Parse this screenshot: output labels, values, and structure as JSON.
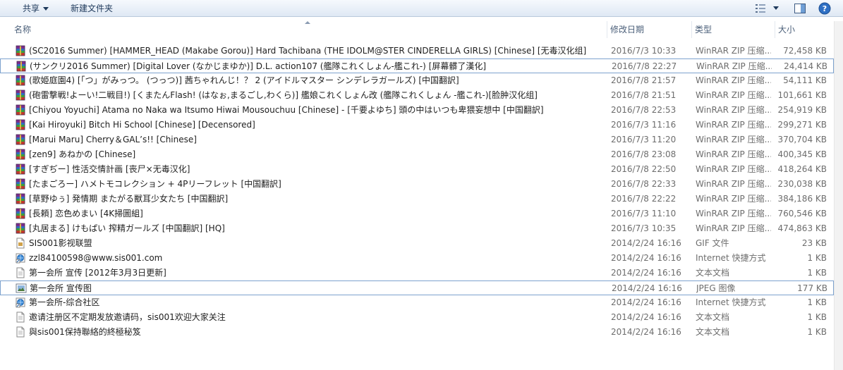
{
  "toolbar": {
    "share_label": "共享",
    "new_folder_label": "新建文件夹",
    "view_icon": "view-options-icon",
    "preview_icon": "preview-pane-icon",
    "help_icon": "help-icon"
  },
  "columns": {
    "name": "名称",
    "date": "修改日期",
    "type": "类型",
    "size": "大小"
  },
  "files": [
    {
      "icon": "winrar-archive-icon",
      "name": "(SC2016 Summer) [HAMMER_HEAD (Makabe Gorou)] Hard Tachibana (THE IDOLM@STER CINDERELLA GIRLS) [Chinese] [无毒汉化组]",
      "date": "2016/7/3 10:33",
      "type": "WinRAR ZIP 压缩...",
      "size": "72,458 KB",
      "selected": false
    },
    {
      "icon": "winrar-archive-icon",
      "name": "(サンクリ2016 Summer) [Digital Lover (なかじまゆか)] D.L. action107 (艦隊これくしょん-艦これ-) [屏幕髒了漢化]",
      "date": "2016/7/8 22:27",
      "type": "WinRAR ZIP 压缩...",
      "size": "24,414 KB",
      "selected": true
    },
    {
      "icon": "winrar-archive-icon",
      "name": "(歌姫庭園4) [「つ」がみっつ。 (つっつ)] 茜ちゃれんじ！？ 2 (アイドルマスター シンデレラガールズ) [中国翻訳]",
      "date": "2016/7/8 21:57",
      "type": "WinRAR ZIP 压缩...",
      "size": "54,111 KB",
      "selected": false
    },
    {
      "icon": "winrar-archive-icon",
      "name": "(砲雷撃戦!よーい!二戦目!) [くまたんFlash! (はなぉ,まるごし,わくら)] 艦娘これくしょん改 (艦隊これくしょん -艦これ-)[脸肿汉化组]",
      "date": "2016/7/8 21:51",
      "type": "WinRAR ZIP 压缩...",
      "size": "101,661 KB",
      "selected": false
    },
    {
      "icon": "winrar-archive-icon",
      "name": "[Chiyou Yoyuchi] Atama no Naka wa Itsumo Hiwai Mousouchuu [Chinese] - [千要よゆち] 頭の中はいつも卑猥妄想中 [中国翻訳]",
      "date": "2016/7/8 22:53",
      "type": "WinRAR ZIP 压缩...",
      "size": "254,919 KB",
      "selected": false
    },
    {
      "icon": "winrar-archive-icon",
      "name": "[Kai Hiroyuki] Bitch Hi School [Chinese] [Decensored]",
      "date": "2016/7/3 11:16",
      "type": "WinRAR ZIP 压缩...",
      "size": "299,271 KB",
      "selected": false
    },
    {
      "icon": "winrar-archive-icon",
      "name": "[Marui Maru] Cherry＆GAL’s!! [Chinese]",
      "date": "2016/7/3 11:20",
      "type": "WinRAR ZIP 压缩...",
      "size": "370,704 KB",
      "selected": false
    },
    {
      "icon": "winrar-archive-icon",
      "name": "[zen9] あねかの [Chinese]",
      "date": "2016/7/8 23:08",
      "type": "WinRAR ZIP 压缩...",
      "size": "400,345 KB",
      "selected": false
    },
    {
      "icon": "winrar-archive-icon",
      "name": "[すぎぢー] 性活交情計画 [丧尸×无毒汉化]",
      "date": "2016/7/8 22:50",
      "type": "WinRAR ZIP 压缩...",
      "size": "418,264 KB",
      "selected": false
    },
    {
      "icon": "winrar-archive-icon",
      "name": "[たまごろー] ハメトモコレクション + 4Pリーフレット [中国翻訳]",
      "date": "2016/7/8 22:33",
      "type": "WinRAR ZIP 压缩...",
      "size": "230,038 KB",
      "selected": false
    },
    {
      "icon": "winrar-archive-icon",
      "name": "[草野ゆぅ] 発情期 またがる獣耳少女たち [中国翻訳]",
      "date": "2016/7/8 22:22",
      "type": "WinRAR ZIP 压缩...",
      "size": "384,186 KB",
      "selected": false
    },
    {
      "icon": "winrar-archive-icon",
      "name": "[長頼] 恋色めまい [4K掃圖組]",
      "date": "2016/7/3 11:10",
      "type": "WinRAR ZIP 压缩...",
      "size": "760,546 KB",
      "selected": false
    },
    {
      "icon": "winrar-archive-icon",
      "name": "[丸居まる] けもぱい 搾精ガールズ [中国翻訳] [HQ]",
      "date": "2016/7/3 10:35",
      "type": "WinRAR ZIP 压缩...",
      "size": "474,863 KB",
      "selected": false
    },
    {
      "icon": "gif-file-icon",
      "name": "SIS001影视联盟",
      "date": "2014/2/24 16:16",
      "type": "GIF 文件",
      "size": "23 KB",
      "selected": false
    },
    {
      "icon": "internet-shortcut-icon",
      "name": "zzl84100598@www.sis001.com",
      "date": "2014/2/24 16:16",
      "type": "Internet 快捷方式",
      "size": "1 KB",
      "selected": false
    },
    {
      "icon": "text-document-icon",
      "name": "第一会所 宣传 [2012年3月3日更新]",
      "date": "2014/2/24 16:16",
      "type": "文本文档",
      "size": "1 KB",
      "selected": false
    },
    {
      "icon": "jpeg-image-icon",
      "name": "第一会所 宣传图",
      "date": "2014/2/24 16:16",
      "type": "JPEG 图像",
      "size": "177 KB",
      "selected": true
    },
    {
      "icon": "internet-shortcut-icon",
      "name": "第一会所-综合社区",
      "date": "2014/2/24 16:16",
      "type": "Internet 快捷方式",
      "size": "1 KB",
      "selected": false
    },
    {
      "icon": "text-document-icon",
      "name": "邀请注册区不定期发放邀请码，sis001欢迎大家关注",
      "date": "2014/2/24 16:16",
      "type": "文本文档",
      "size": "1 KB",
      "selected": false
    },
    {
      "icon": "text-document-icon",
      "name": "與sis001保持聯絡的終極秘笈",
      "date": "2014/2/24 16:16",
      "type": "文本文档",
      "size": "1 KB",
      "selected": false
    }
  ]
}
